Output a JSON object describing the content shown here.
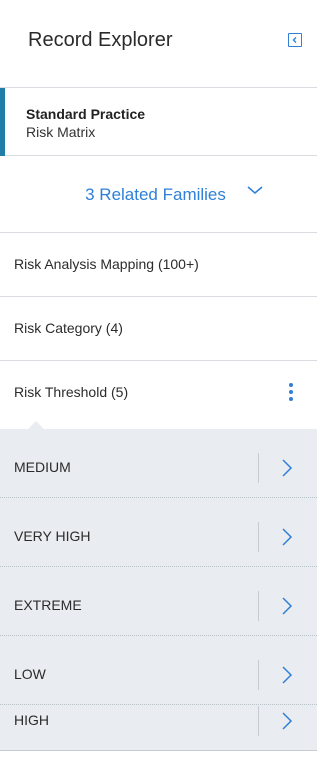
{
  "header": {
    "title": "Record Explorer",
    "collapse_icon": "chevron-left-square-icon",
    "accent_color": "#2f80d6"
  },
  "record": {
    "title": "Standard Practice",
    "subtitle": "Risk Matrix",
    "accent_color": "#1f7da8"
  },
  "related": {
    "label": "3 Related Families",
    "toggle_icon": "chevron-down-icon"
  },
  "families": [
    {
      "label": "Risk Analysis Mapping (100+)"
    },
    {
      "label": "Risk Category (4)"
    },
    {
      "label": "Risk Threshold  (5)",
      "menu_icon": "kebab-menu-icon",
      "expanded": true
    }
  ],
  "threshold_records": [
    {
      "label": "MEDIUM"
    },
    {
      "label": "VERY HIGH"
    },
    {
      "label": "EXTREME"
    },
    {
      "label": "LOW"
    },
    {
      "label": "HIGH"
    }
  ]
}
